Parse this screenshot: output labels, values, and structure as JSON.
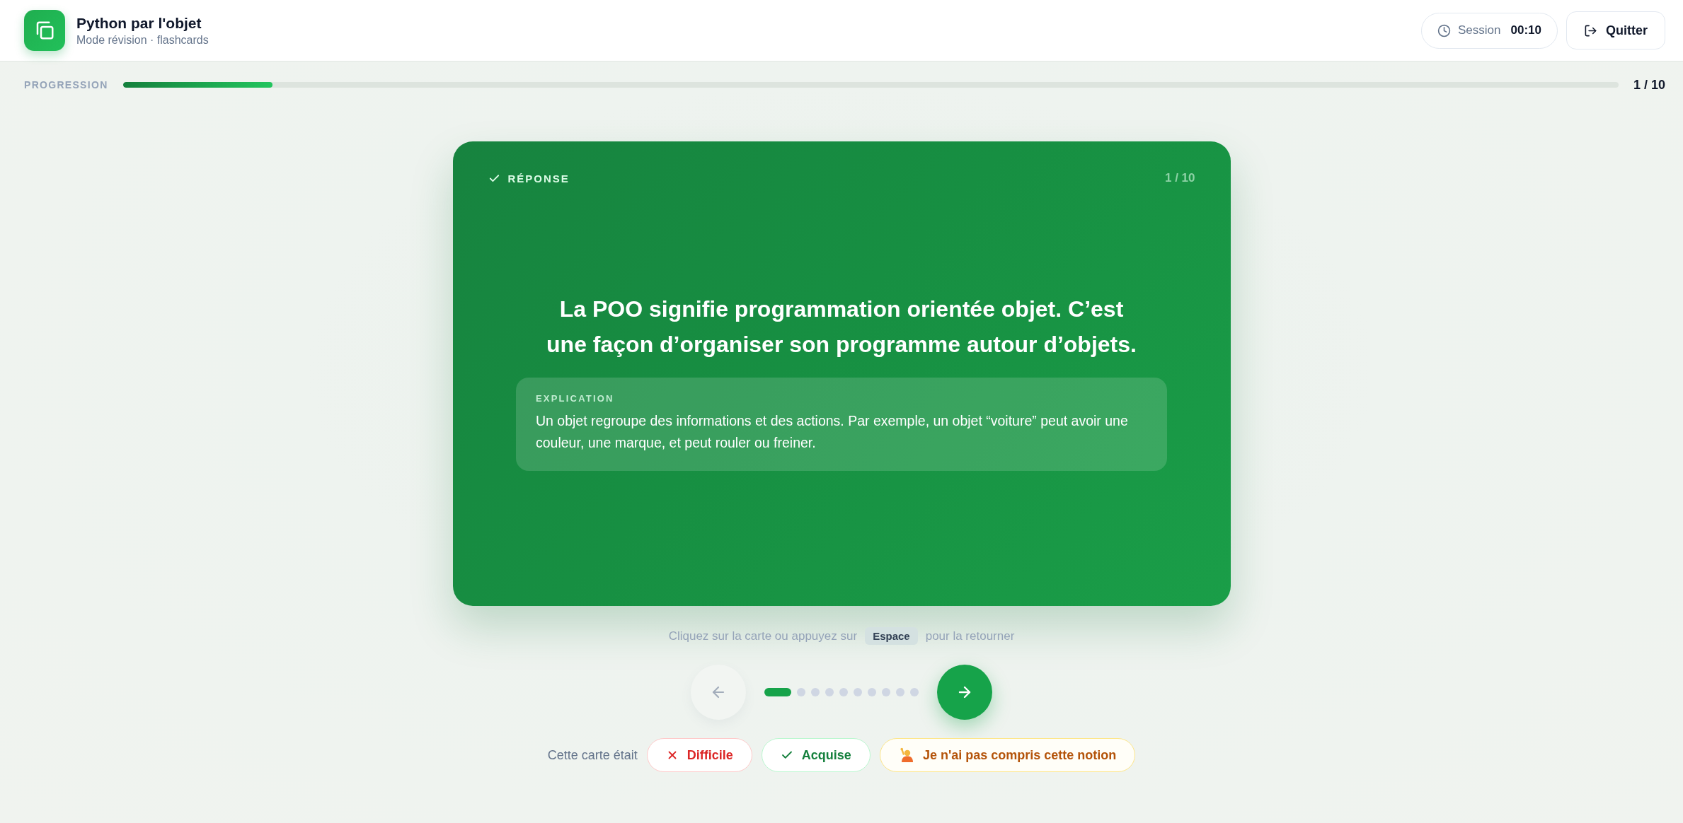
{
  "header": {
    "title": "Python par l'objet",
    "subtitle": "Mode révision · flashcards",
    "session": {
      "label": "Session",
      "time": "00:10"
    },
    "quit_button": "Quitter"
  },
  "progress": {
    "label": "PROGRESSION",
    "level": 0.1,
    "count": "1 / 10"
  },
  "card": {
    "face_label": "RÉPONSE",
    "position": "1 / 10",
    "answer": "La POO signifie programmation orientée objet. C’est une façon d’organiser son programme autour d’objets.",
    "explanation": {
      "label": "EXPLICATION",
      "text": "Un objet regroupe des informations et des actions. Par exemple, un objet “voiture” peut avoir une couleur, une marque, et peut rouler ou freiner."
    }
  },
  "hint": {
    "before": "Cliquez sur la carte ou appuyez sur",
    "key": "Espace",
    "after": "pour la retourner"
  },
  "navigation": {
    "previous": {
      "disabled": true
    },
    "next": {
      "disabled": false
    },
    "dots": [
      {
        "selected": true
      },
      {
        "selected": false
      },
      {
        "selected": false
      },
      {
        "selected": false
      },
      {
        "selected": false
      },
      {
        "selected": false
      },
      {
        "selected": false
      },
      {
        "selected": false
      },
      {
        "selected": false
      },
      {
        "selected": false
      }
    ]
  },
  "rating": {
    "label": "Cette carte était",
    "options": [
      {
        "kind": "difficult",
        "label": "Difficile"
      },
      {
        "kind": "known",
        "label": "Acquise"
      },
      {
        "kind": "unclear",
        "label": "Je n'ai pas compris cette notion"
      }
    ]
  }
}
